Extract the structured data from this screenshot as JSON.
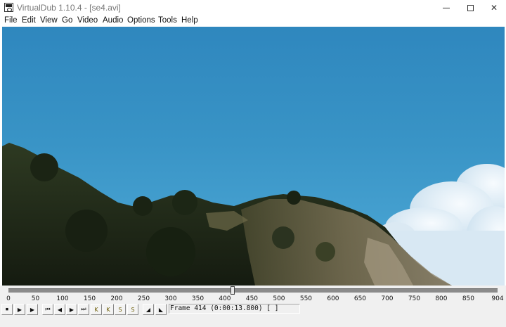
{
  "window": {
    "title": "VirtualDub 1.10.4 - [se4.avi]",
    "controls": {
      "minimize_icon": "minimize-icon",
      "maximize_icon": "maximize-icon",
      "close_icon": "close-icon",
      "close_glyph": "✕"
    }
  },
  "menu": {
    "items": [
      "File",
      "Edit",
      "View",
      "Go",
      "Video",
      "Audio",
      "Options",
      "Tools",
      "Help"
    ]
  },
  "timeline": {
    "min": 0,
    "max": 904,
    "current_frame": 414,
    "tick_labels": [
      "0",
      "50",
      "100",
      "150",
      "200",
      "250",
      "300",
      "350",
      "400",
      "450",
      "500",
      "550",
      "600",
      "650",
      "700",
      "750",
      "800",
      "850",
      "904"
    ]
  },
  "status": {
    "frame_text": "Frame 414 (0:00:13.800) [ ]"
  },
  "toolbar": {
    "buttons": [
      {
        "name": "stop-icon",
        "glyph": "⏹"
      },
      {
        "name": "play-input-icon",
        "glyph": "▶"
      },
      {
        "name": "play-output-icon",
        "glyph": "▶"
      },
      {
        "name": "go-start-icon",
        "glyph": "⏮"
      },
      {
        "name": "prev-frame-icon",
        "glyph": "◀"
      },
      {
        "name": "next-frame-icon",
        "glyph": "▶"
      },
      {
        "name": "go-end-icon",
        "glyph": "⏭"
      },
      {
        "name": "prev-keyframe-icon",
        "glyph": "K"
      },
      {
        "name": "next-keyframe-icon",
        "glyph": "K"
      },
      {
        "name": "prev-scene-icon",
        "glyph": "S"
      },
      {
        "name": "next-scene-icon",
        "glyph": "S"
      },
      {
        "name": "mark-in-icon",
        "glyph": "◢"
      },
      {
        "name": "mark-out-icon",
        "glyph": "◣"
      }
    ]
  },
  "colors": {
    "sky_top": "#2f87be",
    "sky_bottom": "#55aad8",
    "hill_dark": "#1f2a1a",
    "hill_rock": "#8a7d63",
    "cloud": "#eef5fb"
  }
}
